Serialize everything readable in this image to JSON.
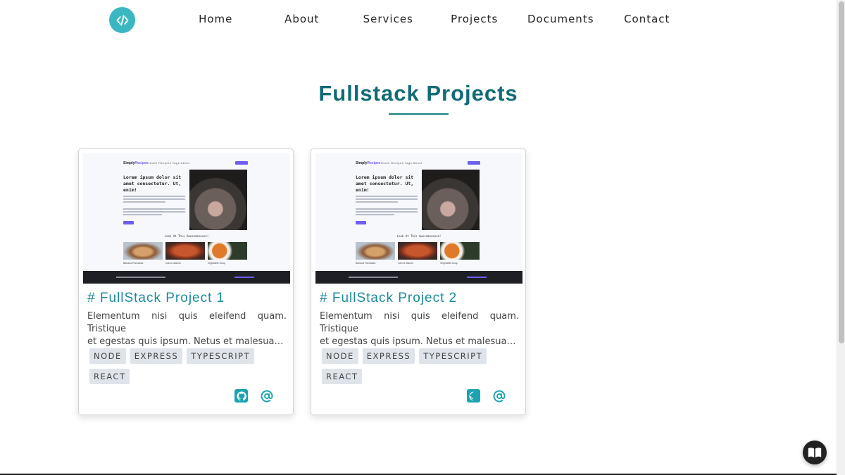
{
  "nav": {
    "logo_icon": "code-icon",
    "links": [
      "Home",
      "About",
      "Services",
      "Projects",
      "Documents",
      "Contact"
    ]
  },
  "section": {
    "title": "Fullstack Projects"
  },
  "projects": [
    {
      "title": "# FullStack Project 1",
      "description_line1": "Elementum nisi quis eleifend quam. Tristique",
      "description_line2": "et egestas quis ipsum. Netus et malesuada fames ac turpis",
      "tags": [
        "NODE",
        "EXPRESS",
        "TYPESCRIPT",
        "REACT"
      ],
      "thumbnail": {
        "brand": "Simply",
        "brand_accent": "Recipes",
        "nav": "Home  Recipes  Tags  About",
        "hero_heading": "Lorem ipsum dolor sit amet consectetur. Ut, enim!",
        "subheading": "Look At This Awesomesouce!",
        "foods": [
          "Banana Pancakes",
          "Carrot Jasmin",
          "Vegetable Soup"
        ]
      },
      "links": [
        "github-icon",
        "at-icon"
      ]
    },
    {
      "title": "# FullStack Project 2",
      "description_line1": "Elementum nisi quis eleifend quam. Tristique",
      "description_line2": "et egestas quis ipsum. Netus et malesuada fames ac turpis",
      "tags": [
        "NODE",
        "EXPRESS",
        "TYPESCRIPT",
        "REACT"
      ],
      "thumbnail": {
        "brand": "Simply",
        "brand_accent": "Recipes",
        "nav": "Home  Recipes  Tags  About",
        "hero_heading": "Lorem ipsum dolor sit amet consectetur. Ut, enim!",
        "subheading": "Look At This Awesomesouce!",
        "foods": [
          "Banana Pancakes",
          "Carrot Jasmin",
          "Vegetable Soup"
        ]
      },
      "links": [
        "github-icon",
        "at-icon"
      ]
    }
  ],
  "floating_button": {
    "icon": "book-icon"
  },
  "colors": {
    "accent": "#3ab7c1",
    "title": "#106b76",
    "card_title": "#1b8a9a",
    "tag_bg": "#dfe4ea"
  }
}
